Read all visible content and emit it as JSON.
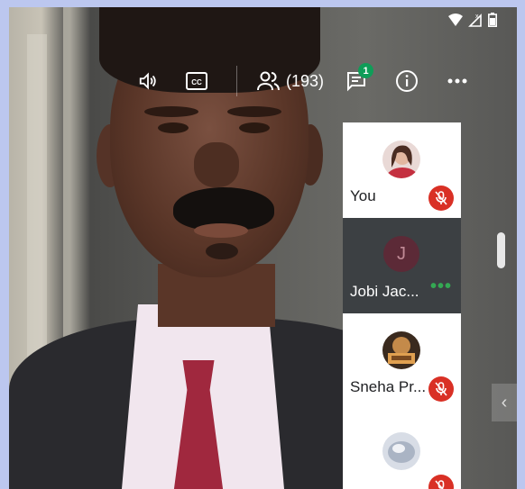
{
  "status_bar": {
    "icons": [
      "wifi-icon",
      "no-signal-icon",
      "battery-icon"
    ]
  },
  "toolbar": {
    "volume_icon": "volume-icon",
    "captions_label": "CC",
    "participants_count": "(193)",
    "chat_badge": "1",
    "info_icon": "info-icon",
    "more_icon": "more-icon"
  },
  "participants": [
    {
      "name": "You",
      "muted": true,
      "avatar": "photo"
    },
    {
      "name": "Jobi Jac...",
      "initial": "J",
      "speaking": true
    },
    {
      "name": "Sneha Pr...",
      "muted": true,
      "avatar": "photo"
    },
    {
      "name": "",
      "muted": true,
      "avatar": "photo"
    }
  ],
  "colors": {
    "accent_green": "#0f9d58",
    "mute_red": "#d93025",
    "page_border": "#bcc7ef"
  }
}
